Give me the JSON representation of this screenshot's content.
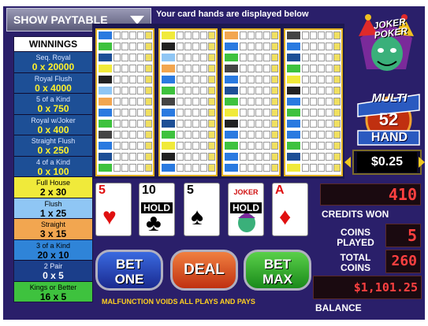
{
  "top": {
    "paytable_label": "SHOW PAYTABLE",
    "hands_note": "Your card hands are displayed below"
  },
  "winnings": {
    "title": "WINNINGS",
    "rows": [
      {
        "name": "Seq. Royal",
        "value": "0 x 20000",
        "style": "blue"
      },
      {
        "name": "Royal Flush",
        "value": "0 x 4000",
        "style": "blue"
      },
      {
        "name": "5 of a Kind",
        "value": "0 x 750",
        "style": "blue"
      },
      {
        "name": "Royal w/Joker",
        "value": "0 x 400",
        "style": "blue"
      },
      {
        "name": "Straight Flush",
        "value": "0 x 250",
        "style": "blue"
      },
      {
        "name": "4 of a Kind",
        "value": "0 x 100",
        "style": "blue"
      },
      {
        "name": "Full House",
        "value": "2 x 30",
        "style": "yellow"
      },
      {
        "name": "Flush",
        "value": "1 x 25",
        "style": "lblue"
      },
      {
        "name": "Straight",
        "value": "3 x 15",
        "style": "orange"
      },
      {
        "name": "3 of a Kind",
        "value": "20 x 10",
        "style": "mblue"
      },
      {
        "name": "2 Pair",
        "value": "0 x 5",
        "style": "dblue"
      },
      {
        "name": "Kings or Better",
        "value": "16 x 5",
        "style": "green"
      }
    ]
  },
  "logo": {
    "line1": "JOKER",
    "line2": "POKER"
  },
  "badge": {
    "multi": "MULTI",
    "number": "52",
    "hand": "HAND"
  },
  "denomination": "$0.25",
  "cards": [
    {
      "rank": "5",
      "suit": "♥",
      "color": "red",
      "hold": ""
    },
    {
      "rank": "10",
      "suit": "♣",
      "color": "blk",
      "hold": "HOLD"
    },
    {
      "rank": "5",
      "suit": "♠",
      "color": "blk",
      "hold": ""
    },
    {
      "rank": "JOKER",
      "suit": "",
      "color": "red",
      "hold": "HOLD"
    },
    {
      "rank": "A",
      "suit": "♦",
      "color": "red",
      "hold": ""
    }
  ],
  "displays": {
    "credits_won": "410",
    "credits_won_label": "CREDITS WON",
    "coins_played_label_1": "COINS",
    "coins_played_label_2": "PLAYED",
    "coins_played": "5",
    "total_coins_label_1": "TOTAL",
    "total_coins_label_2": "COINS",
    "total_coins": "260",
    "balance": "$1,101.25",
    "balance_label": "BALANCE"
  },
  "buttons": {
    "bet_one_1": "BET",
    "bet_one_2": "ONE",
    "deal": "DEAL",
    "bet_max_1": "BET",
    "bet_max_2": "MAX"
  },
  "footer_note": "MALFUNCTION VOIDS ALL PLAYS AND PAYS"
}
